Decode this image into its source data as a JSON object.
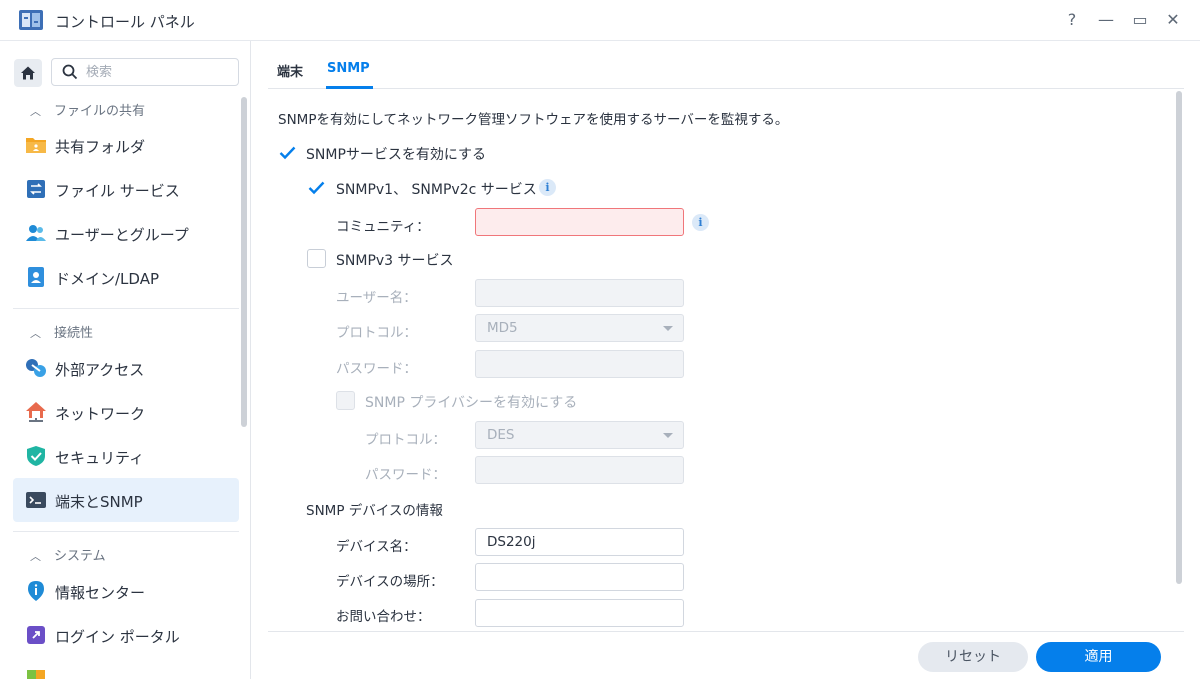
{
  "window": {
    "title": "コントロール パネル",
    "help": "?",
    "minimize": "—",
    "maximize": "▭",
    "close": "✕"
  },
  "sidebar": {
    "search_placeholder": "検索",
    "sections": [
      {
        "title": "ファイルの共有",
        "items": [
          {
            "label": "共有フォルダ",
            "icon": "shared-folder-icon"
          },
          {
            "label": "ファイル サービス",
            "icon": "file-services-icon"
          },
          {
            "label": "ユーザーとグループ",
            "icon": "user-group-icon"
          },
          {
            "label": "ドメイン/LDAP",
            "icon": "domain-ldap-icon"
          }
        ]
      },
      {
        "title": "接続性",
        "items": [
          {
            "label": "外部アクセス",
            "icon": "external-access-icon"
          },
          {
            "label": "ネットワーク",
            "icon": "network-icon"
          },
          {
            "label": "セキュリティ",
            "icon": "security-icon"
          },
          {
            "label": "端末とSNMP",
            "icon": "terminal-snmp-icon",
            "active": true
          }
        ]
      },
      {
        "title": "システム",
        "items": [
          {
            "label": "情報センター",
            "icon": "info-center-icon"
          },
          {
            "label": "ログイン ポータル",
            "icon": "login-portal-icon"
          }
        ]
      }
    ]
  },
  "tabs": [
    {
      "label": "端末",
      "active": false
    },
    {
      "label": "SNMP",
      "active": true
    }
  ],
  "snmp": {
    "description": "SNMPを有効にしてネットワーク管理ソフトウェアを使用するサーバーを監視する。",
    "enable_label": "SNMPサービスを有効にする",
    "enable_checked": true,
    "v1v2c_label": "SNMPv1、 SNMPv2c サービス",
    "v1v2c_checked": true,
    "community_label": "コミュニティ：",
    "community_value": "",
    "v3_label": "SNMPv3 サービス",
    "v3_checked": false,
    "username_label": "ユーザー名：",
    "username_value": "",
    "protocol_label": "プロトコル：",
    "protocol_value": "MD5",
    "password_label": "パスワード：",
    "password_value": "",
    "privacy_label": "SNMP プライバシーを有効にする",
    "privacy_checked": false,
    "privacy_protocol_label": "プロトコル：",
    "privacy_protocol_value": "DES",
    "privacy_password_label": "パスワード：",
    "privacy_password_value": "",
    "device_section": "SNMP デバイスの情報",
    "device_name_label": "デバイス名：",
    "device_name_value": "DS220j",
    "device_location_label": "デバイスの場所：",
    "device_location_value": "",
    "contact_label": "お問い合わせ：",
    "contact_value": ""
  },
  "footer": {
    "reset": "リセット",
    "apply": "適用"
  },
  "colors": {
    "accent": "#057feb",
    "error_border": "#f0767a",
    "active_bg": "#e7f1fc"
  }
}
